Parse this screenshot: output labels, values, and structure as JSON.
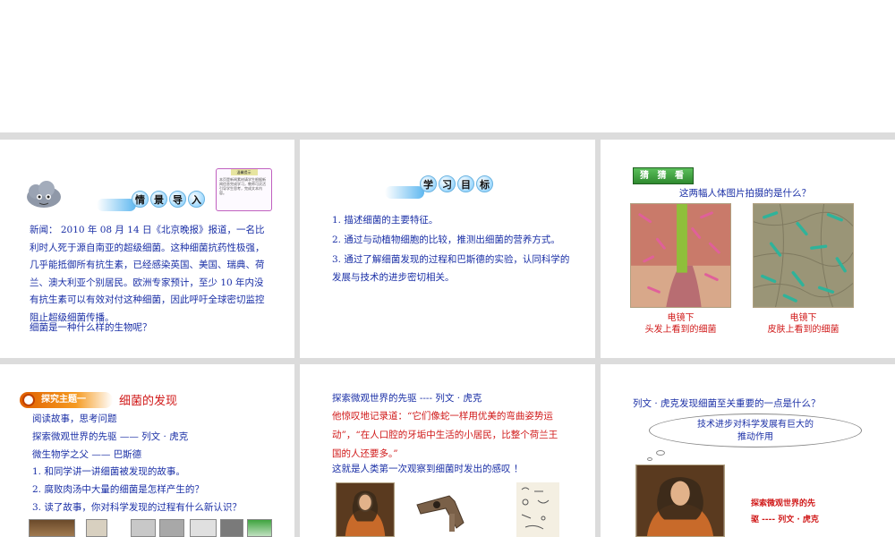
{
  "slide1": {
    "banner_chars": [
      "情",
      "景",
      "导",
      "入"
    ],
    "tip_title": "温馨提示",
    "tip_text": "本页是新闻素材请学生根据新闻信息完成学习，教师可灵活引导学生思考，完成文本内容。",
    "paragraph": "新闻： 2010 年 08 月 14 日《北京晚报》报道，一名比利时人死于源自南亚的超级细菌。这种细菌抗药性极强，几乎能抵御所有抗生素，已经感染英国、美国、瑞典、荷兰、澳大利亚个别居民。欧洲专家预计，至少 10 年内没有抗生素可以有效对付这种细菌，因此呼吁全球密切监控阻止超级细菌传播。",
    "question": "细菌是一种什么样的生物呢？"
  },
  "slide2": {
    "banner_chars": [
      "学",
      "习",
      "目",
      "标"
    ],
    "goal1": "1. 描述细菌的主要特征。",
    "goal2": "2. 通过与动植物细胞的比较，推测出细菌的营养方式。",
    "goal3": "3. 通过了解细菌发现的过程和巴斯德的实验，认同科学的发展与技术的进步密切相关。"
  },
  "slide3": {
    "tag": "猜 猜 看",
    "question": "这两幅人体图片拍摄的是什么？",
    "cap1_line1": "电镜下",
    "cap1_line2": "头发上看到的细菌",
    "cap2_line1": "电镜下",
    "cap2_line2": "皮肤上看到的细菌"
  },
  "slide4": {
    "tag": "探究主题一",
    "title": "细菌的发现",
    "line1": "阅读故事，思考问题",
    "line2": "探索微观世界的先驱 —— 列文 · 虎克",
    "line3": "微生物学之父 —— 巴斯德",
    "q1": "1. 和同学讲一讲细菌被发现的故事。",
    "q2": "2. 腐败肉汤中大量的细菌是怎样产生的？",
    "q3": "3. 读了故事，你对科学发现的过程有什么新认识？"
  },
  "slide5": {
    "title": "探索微观世界的先驱 ---- 列文 · 虎克",
    "quote": "他惊叹地记录道：“它们像蛇一样用优美的弯曲姿势运动”，“在人口腔的牙垢中生活的小居民，比整个荷兰王国的人还要多。”",
    "note": "这就是人类第一次观察到细菌时发出的感叹 ！"
  },
  "slide6": {
    "question": "列文 · 虎克发现细菌至关重要的一点是什么？",
    "bubble_line1": "技术进步对科学发展有巨大的",
    "bubble_line2": "推动作用",
    "side_line1": "探索微观世界的先",
    "side_line2": "驱 ---- 列文 · 虎克"
  }
}
